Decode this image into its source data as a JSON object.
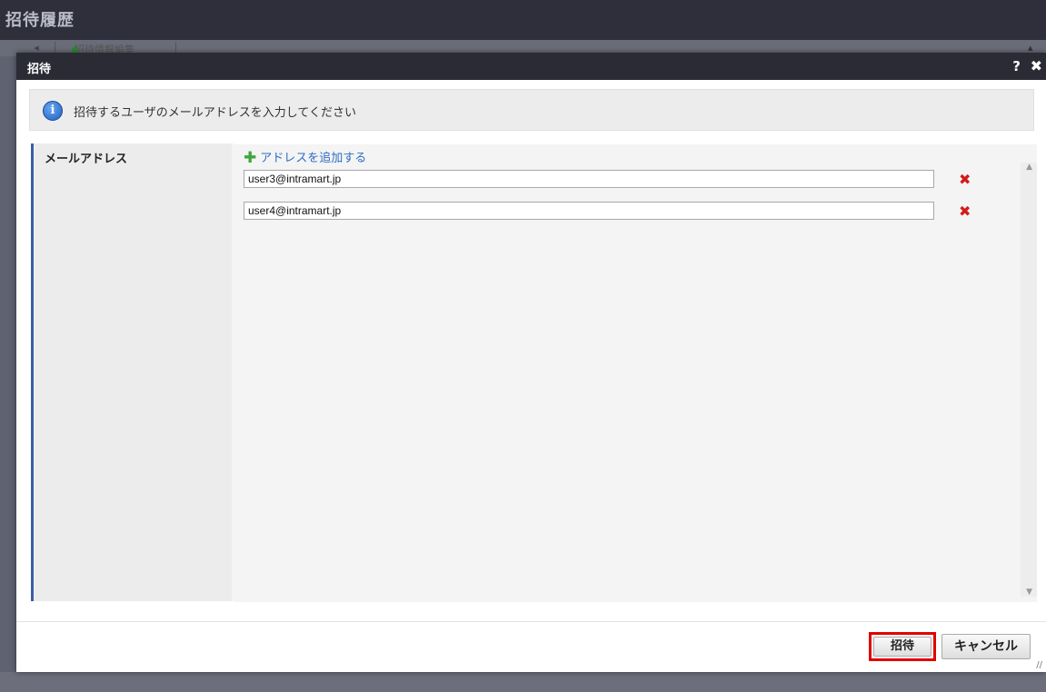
{
  "background": {
    "title": "招待履歴",
    "back_symbol": "◂",
    "tab_label": "招待情報編集",
    "tab_icon": "green-triangle-icon",
    "scroll_symbol": "▴"
  },
  "dialog": {
    "title": "招待",
    "help_label": "?",
    "close_label": "✖",
    "info_icon_glyph": "i",
    "info_message": "招待するユーザのメールアドレスを入力してください",
    "field_label": "メールアドレス",
    "add_address_label": "アドレスを追加する",
    "add_icon_glyph": "✚",
    "emails": [
      "user3@intramart.jp",
      "user4@intramart.jp"
    ],
    "remove_glyph": "✖",
    "scroll_up": "▲",
    "scroll_down": "▼",
    "invite_button": "招待",
    "cancel_button": "キャンセル",
    "resize_glyph": "//"
  },
  "colors": {
    "titlebar": "#2a2b35",
    "accent_border": "#3b5ea8",
    "link": "#2f6ec5",
    "add_icon": "#3ea63a",
    "remove_icon": "#d11b1b",
    "highlight": "#e00000"
  }
}
